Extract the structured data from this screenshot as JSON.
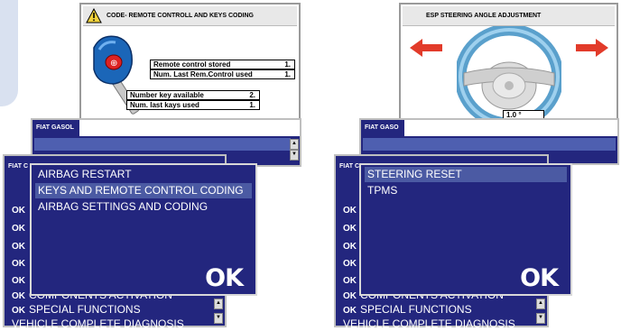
{
  "left": {
    "header_title": "CODE- REMOTE CONTROLL AND KEYS CODING",
    "info": [
      {
        "label": "Remote control stored",
        "value": "1."
      },
      {
        "label": "Num. Last Rem.Control used",
        "value": "1."
      },
      {
        "label": "Number key available",
        "value": "2."
      },
      {
        "label": "Num. last kays used",
        "value": "1."
      }
    ],
    "back_title_1": "FIAT GASOL",
    "back_title_2": "FIAT C",
    "ok_rows": [
      "OK",
      "OK",
      "OK",
      "OK",
      "OK"
    ],
    "menu_items": [
      "AIRBAG RESTART",
      "KEYS AND REMOTE CONTROL CODING",
      "AIRBAG SETTINGS AND CODING"
    ],
    "selected_index": 1,
    "ok_button": "OK",
    "bottom_rows": [
      {
        "ok": "OK",
        "label": "COMPONENTS ACTIVATION"
      },
      {
        "ok": "OK",
        "label": "SPECIAL FUNCTIONS"
      },
      {
        "ok": "",
        "label": "VEHICLE COMPLETE DIAGNOSIS"
      }
    ]
  },
  "right": {
    "header_title": "ESP  STEERING ANGLE ADJUSTMENT",
    "angle_value": "1.0 °",
    "back_title_1": "FIAT GASO",
    "back_title_2": "FIAT C",
    "ok_rows": [
      "OK",
      "OK",
      "OK",
      "OK",
      "OK"
    ],
    "menu_items": [
      "STEERING RESET",
      "TPMS"
    ],
    "selected_index": 0,
    "ok_button": "OK",
    "bottom_rows": [
      {
        "ok": "OK",
        "label": "COMPONENTS ACTIVATION"
      },
      {
        "ok": "OK",
        "label": "SPECIAL FUNCTIONS"
      },
      {
        "ok": "",
        "label": "VEHICLE COMPLETE DIAGNOSIS"
      }
    ]
  },
  "colors": {
    "navy": "#23267e",
    "selected": "#4b5aa3",
    "arrow": "#e23b2a",
    "warning": "#f2d23c"
  },
  "icons": [
    "warning-icon",
    "car-key-icon",
    "steering-wheel-icon",
    "left-arrow-icon",
    "right-arrow-icon"
  ]
}
